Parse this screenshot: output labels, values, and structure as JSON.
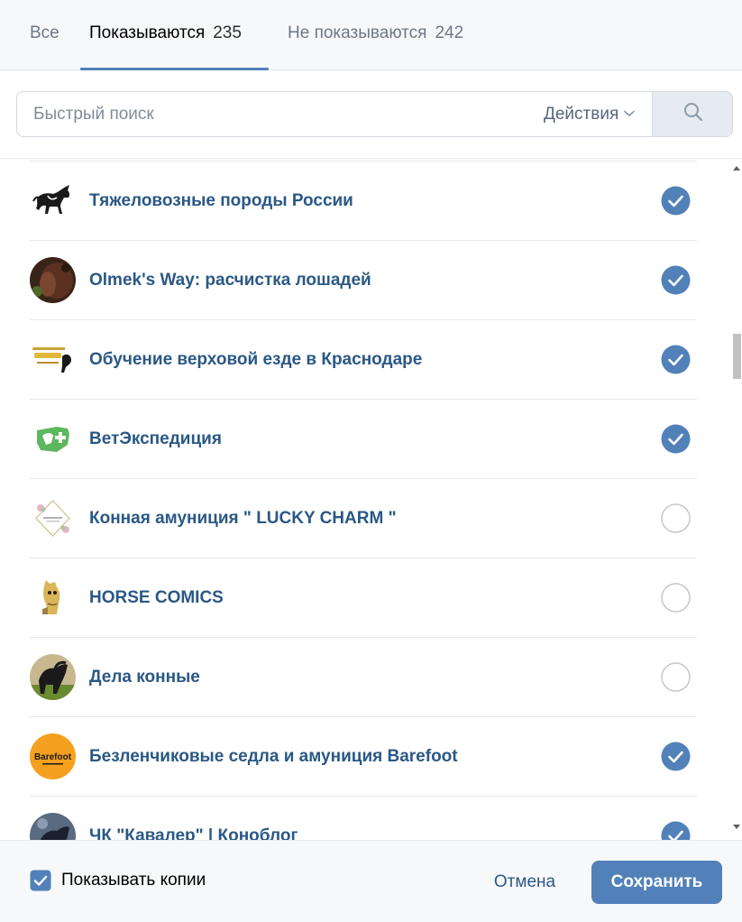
{
  "tabs": [
    {
      "label": "Все",
      "count": ""
    },
    {
      "label": "Показываются",
      "count": "235"
    },
    {
      "label": "Не показываются",
      "count": "242"
    }
  ],
  "search": {
    "placeholder": "Быстрый поиск",
    "actions_label": "Действия"
  },
  "items": [
    {
      "title": "Тяжеловозные породы России",
      "checked": true
    },
    {
      "title": "Olmek's Way: расчистка лошадей",
      "checked": true
    },
    {
      "title": "Обучение верховой езде в Краснодаре",
      "checked": true
    },
    {
      "title": "ВетЭкспедиция",
      "checked": true
    },
    {
      "title": "Конная амуниция \" LUCKY CHARM \"",
      "checked": false
    },
    {
      "title": "HORSE COMICS",
      "checked": false
    },
    {
      "title": "Дела конные",
      "checked": false
    },
    {
      "title": "Безленчиковые седла и амуниция Barefoot",
      "checked": true
    },
    {
      "title": "ЧК \"Кавалер\" | Коноблог",
      "checked": true
    }
  ],
  "avatar_text": {
    "barefoot": "Barefoot"
  },
  "footer": {
    "show_copies_label": "Показывать копии",
    "show_copies_checked": true,
    "cancel_label": "Отмена",
    "save_label": "Сохранить"
  },
  "colors": {
    "accent": "#5181b8",
    "link": "#2a5885",
    "check_fill": "#5181b8",
    "unchecked_border": "#c4c8cc"
  }
}
